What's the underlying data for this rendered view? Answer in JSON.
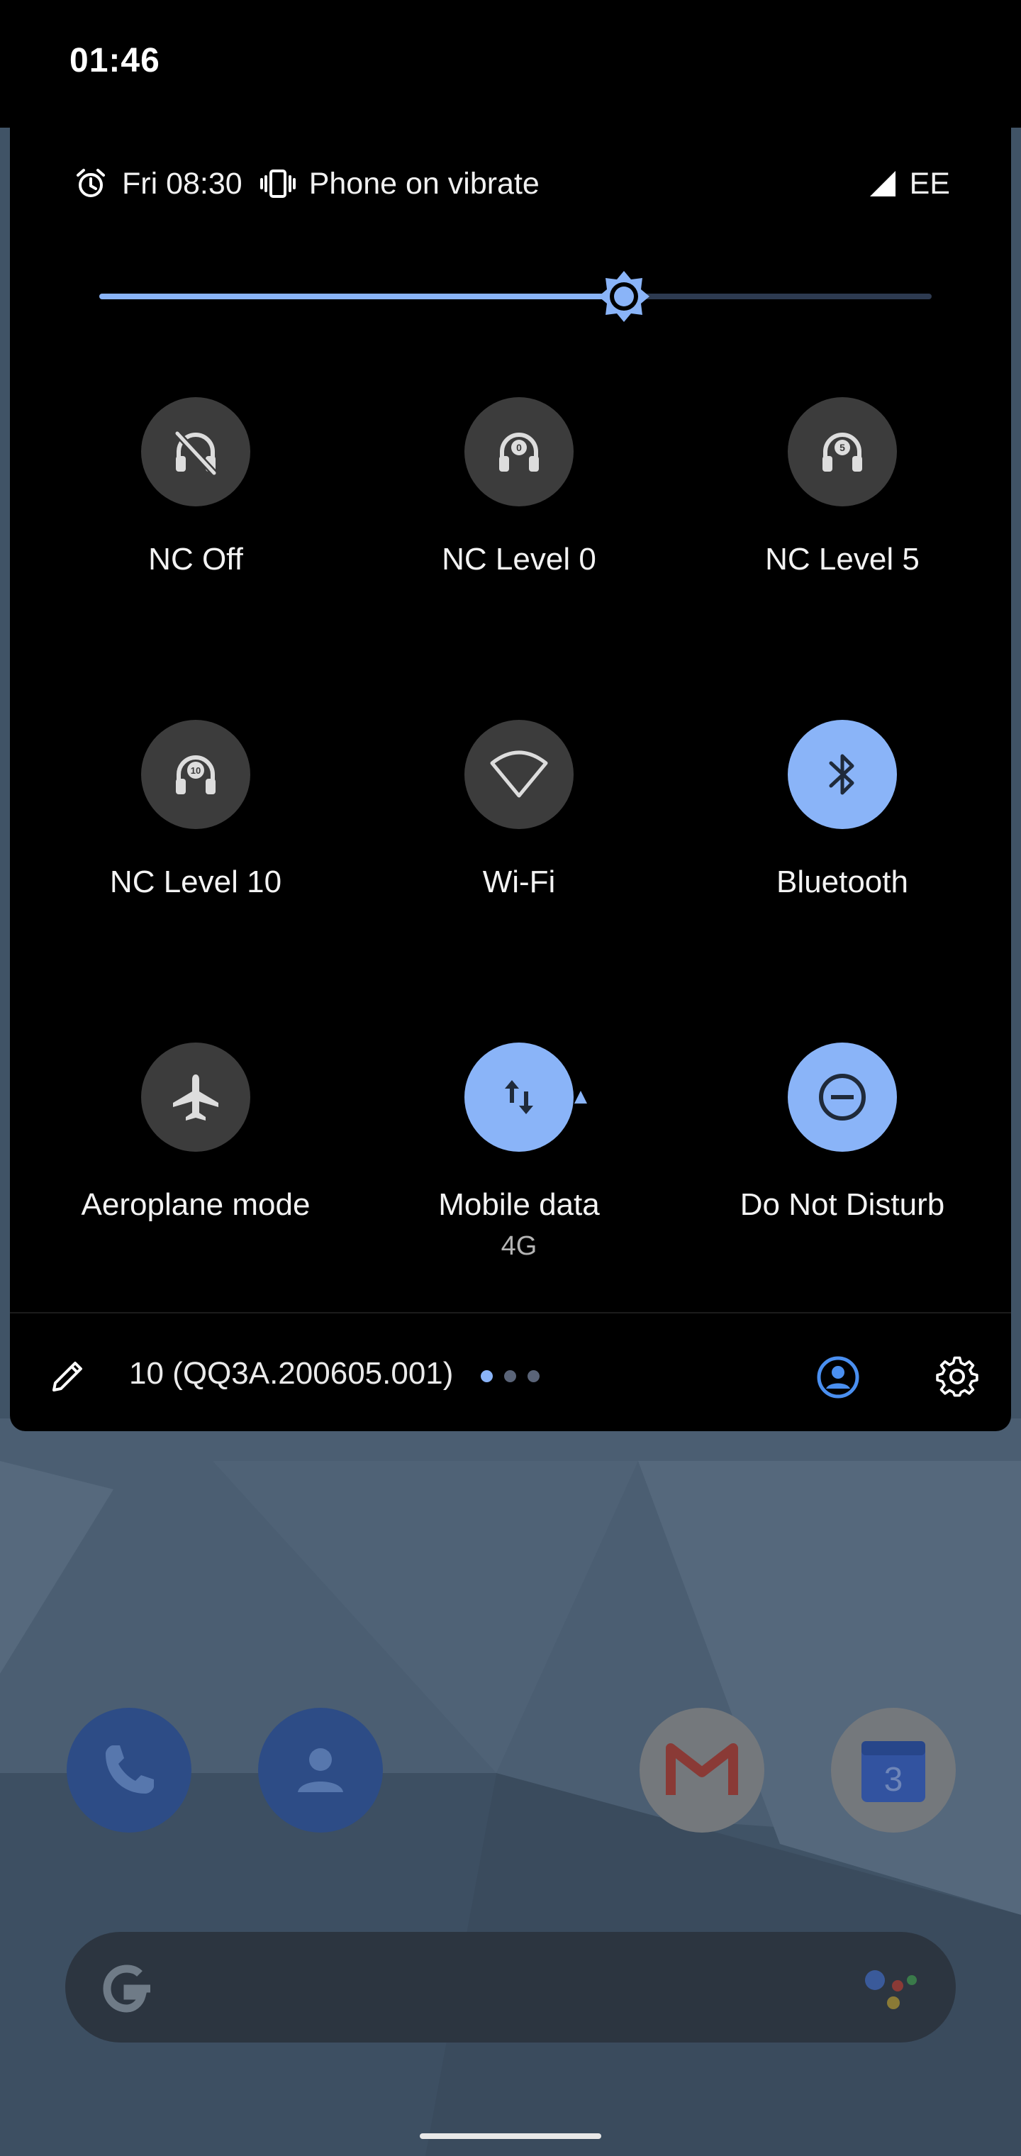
{
  "status_bar": {
    "time": "01:46"
  },
  "quick_settings": {
    "header": {
      "alarm_time": "Fri 08:30",
      "ringer_status": "Phone on vibrate",
      "carrier": "EE"
    },
    "brightness": {
      "level": 0.63
    },
    "tiles": [
      {
        "label": "NC Off",
        "sub": "",
        "icon": "headphones-off-icon",
        "active": false
      },
      {
        "label": "NC Level 0",
        "sub": "",
        "icon": "headphones-level-0-icon",
        "active": false
      },
      {
        "label": "NC Level 5",
        "sub": "",
        "icon": "headphones-level-5-icon",
        "active": false
      },
      {
        "label": "NC Level 10",
        "sub": "",
        "icon": "headphones-level-10-icon",
        "active": false
      },
      {
        "label": "Wi-Fi",
        "sub": "",
        "icon": "wifi-icon",
        "active": false
      },
      {
        "label": "Bluetooth",
        "sub": "",
        "icon": "bluetooth-icon",
        "active": true
      },
      {
        "label": "Aeroplane mode",
        "sub": "",
        "icon": "airplane-icon",
        "active": false
      },
      {
        "label": "Mobile data",
        "sub": "4G",
        "icon": "mobile-data-icon",
        "active": true
      },
      {
        "label": "Do Not Disturb",
        "sub": "",
        "icon": "do-not-disturb-icon",
        "active": true
      }
    ],
    "headphone_badges": [
      "0",
      "5",
      "10"
    ],
    "footer": {
      "build": "10 (QQ3A.200605.001)",
      "page_count": 3,
      "current_page": 0
    }
  },
  "home_screen": {
    "calendar_day": "3"
  },
  "colors": {
    "accent": "#8ab4f8",
    "tile_off": "#3c3c3c",
    "panel_bg": "#000000"
  }
}
